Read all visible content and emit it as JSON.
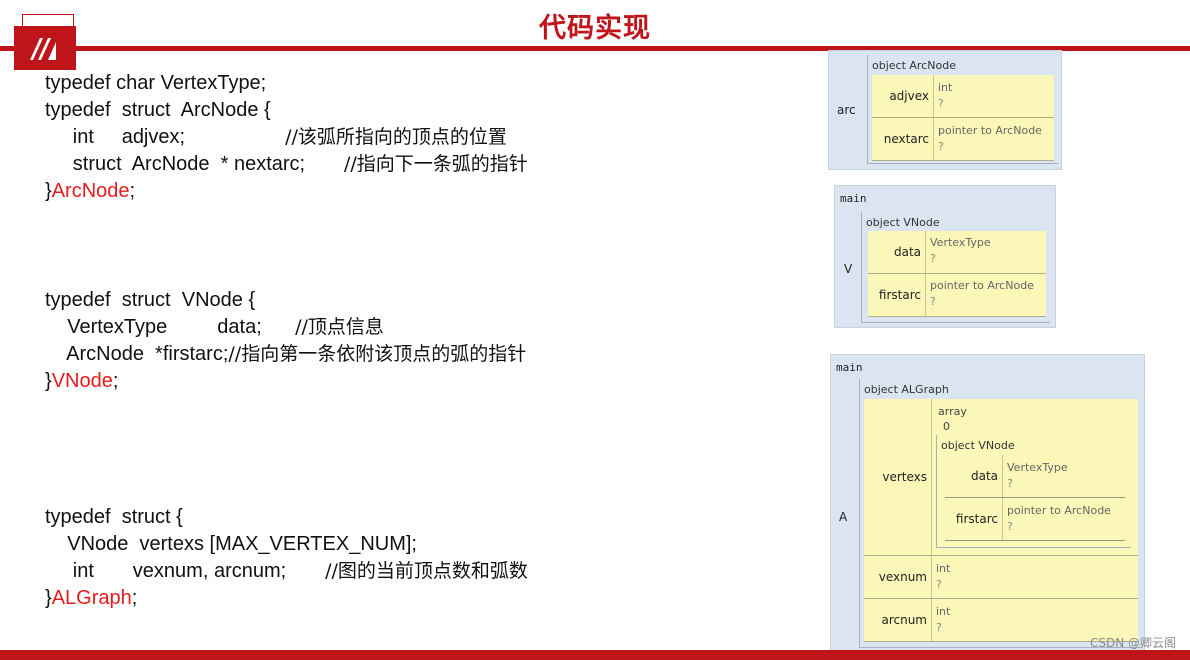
{
  "header": {
    "title": "代码实现"
  },
  "code_blocks": [
    {
      "lines": [
        {
          "text": "typedef char VertexType;"
        },
        {
          "text": "typedef  struct  ArcNode {"
        },
        {
          "text": "     int     adjvex;                  ",
          "comment": "//该弧所指向的顶点的位置"
        },
        {
          "text": "     struct  ArcNode  * nextarc;       ",
          "comment": "//指向下一条弧的指针"
        },
        {
          "text": "}",
          "red": "ArcNode",
          "tail": ";"
        }
      ]
    },
    {
      "lines": [
        {
          "text": "typedef  struct  VNode {"
        },
        {
          "text": "    VertexType         data;      ",
          "comment": "//顶点信息"
        },
        {
          "text": "    ArcNode  *firstarc;",
          "comment": "//指向第一条依附该顶点的弧的指针"
        },
        {
          "text": "}",
          "red": "VNode",
          "tail": ";"
        }
      ]
    },
    {
      "lines": [
        {
          "text": "typedef  struct {"
        },
        {
          "text": "    VNode  vertexs [MAX_VERTEX_NUM];"
        },
        {
          "text": "     int       vexnum, arcnum;       ",
          "comment": "//图的当前顶点数和弧数"
        },
        {
          "text": "}",
          "red": "ALGraph",
          "tail": ";"
        }
      ]
    }
  ],
  "diagrams": {
    "arc": {
      "var": "arc",
      "object_title": "object ArcNode",
      "fields": [
        {
          "name": "adjvex",
          "type": "int",
          "value": "?"
        },
        {
          "name": "nextarc",
          "type": "pointer to ArcNode",
          "value": "?"
        }
      ]
    },
    "vnode": {
      "frame": "main",
      "var": "V",
      "object_title": "object VNode",
      "fields": [
        {
          "name": "data",
          "type": "VertexType",
          "value": "?"
        },
        {
          "name": "firstarc",
          "type": "pointer to ArcNode",
          "value": "?"
        }
      ]
    },
    "algraph": {
      "frame": "main",
      "var": "A",
      "object_title": "object ALGraph",
      "vertexs": {
        "name": "vertexs",
        "array_label": "array",
        "index": "0",
        "object_title": "object VNode",
        "fields": [
          {
            "name": "data",
            "type": "VertexType",
            "value": "?"
          },
          {
            "name": "firstarc",
            "type": "pointer to ArcNode",
            "value": "?"
          }
        ]
      },
      "fields": [
        {
          "name": "vexnum",
          "type": "int",
          "value": "?"
        },
        {
          "name": "arcnum",
          "type": "int",
          "value": "?"
        }
      ]
    }
  },
  "watermark": "CSDN @卿云阁",
  "colors": {
    "accent": "#c0141b",
    "highlight_text": "#e51c1c",
    "panel_bg": "#dbe5f1",
    "cell_bg": "#fbf7b8"
  }
}
